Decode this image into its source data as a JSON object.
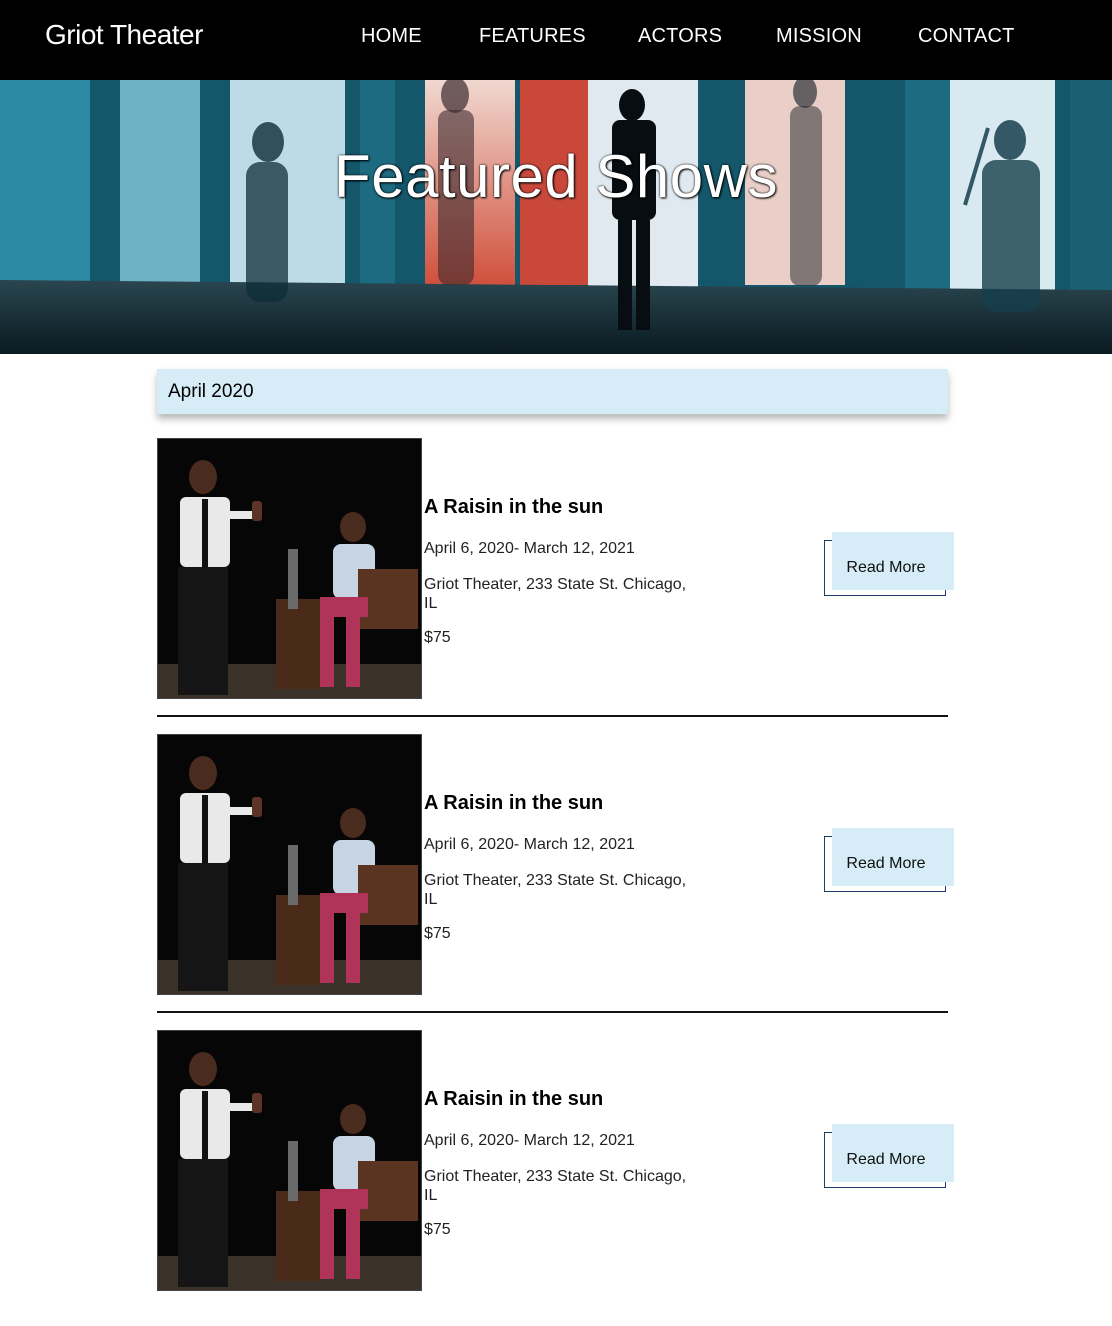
{
  "header": {
    "brand": "Griot Theater",
    "nav": [
      "HOME",
      "FEATURES",
      "ACTORS",
      "MISSION",
      "CONTACT"
    ]
  },
  "hero": {
    "title": "Featured Shows"
  },
  "month": "April 2020",
  "shows": [
    {
      "title": "A Raisin in the sun",
      "dates": "April 6, 2020- March 12, 2021",
      "venue": "Griot Theater, 233 State St. Chicago, IL",
      "price": "$75",
      "button": "Read More"
    },
    {
      "title": "A Raisin in the sun",
      "dates": "April 6, 2020- March 12, 2021",
      "venue": "Griot Theater, 233 State St. Chicago, IL",
      "price": "$75",
      "button": "Read More"
    },
    {
      "title": "A Raisin in the sun",
      "dates": "April 6, 2020- March 12, 2021",
      "venue": "Griot Theater, 233 State St. Chicago, IL",
      "price": "$75",
      "button": "Read More"
    }
  ],
  "colors": {
    "nav_bg": "#000000",
    "accent_light_blue": "#d6ecf6",
    "button_border": "#1d3e6b"
  }
}
